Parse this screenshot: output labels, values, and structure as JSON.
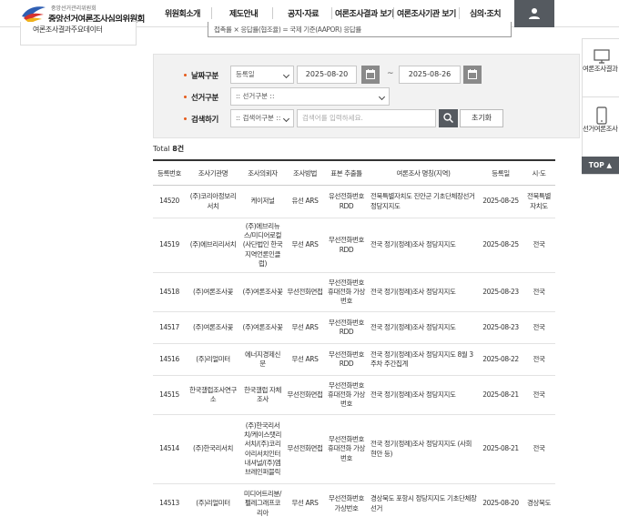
{
  "header": {
    "logo_small": "중앙선거관리위원회",
    "logo_big": "중앙선거여론조사심의위원회",
    "nav": [
      "위원회소개",
      "제도안내",
      "공지·자료",
      "여론조사결과 보기",
      "여론조사기관 보기",
      "심의·조치"
    ]
  },
  "sidebar": {
    "item": "여론조사결과주요데이터"
  },
  "info_strip": {
    "text": "접촉률 × 응답률(협조율) = 국제 기준(AAPOR) 응답률"
  },
  "search": {
    "date_label": "날짜구분",
    "date_type": "등록일",
    "date_from": "2025-08-20",
    "date_to": "2025-08-26",
    "tilde": "~",
    "election_label": "선거구분",
    "election_value": ":: 선거구분 ::",
    "keyword_label": "검색하기",
    "keyword_type": ":: 검색어구분 ::",
    "keyword_placeholder": "검색어를 입력하세요.",
    "reset": "초기화"
  },
  "total": {
    "label": "Total",
    "count": "8건"
  },
  "table": {
    "headers": [
      "등록번호",
      "조사기관명",
      "조사의뢰자",
      "조사방법",
      "표본 추출틀",
      "여론조사 명칭(지역)",
      "등록일",
      "시·도"
    ],
    "rows": [
      {
        "no": "14520",
        "agency": "(주)코리아정보리서치",
        "client": "케이저널",
        "method": "유선 ARS",
        "frame": "유선전화번호 RDD",
        "title": "전북특별자치도 진안군 기초단체장선거 정당지지도",
        "date": "2025-08-25",
        "region": "전북특별자치도"
      },
      {
        "no": "14519",
        "agency": "(주)에브리리서치",
        "client": "(주)에브리뉴스/미디어로컬(사단법인 한국지역언론인클럽)",
        "method": "무선 ARS",
        "frame": "무선전화번호 RDD",
        "title": "전국 정기(정례)조사 정당지지도",
        "date": "2025-08-25",
        "region": "전국"
      },
      {
        "no": "14518",
        "agency": "(주)여론조사꽃",
        "client": "(주)여론조사꽃",
        "method": "무선전화면접",
        "frame": "무선전화번호 휴대전화 가상번호",
        "title": "전국 정기(정례)조사 정당지지도",
        "date": "2025-08-23",
        "region": "전국"
      },
      {
        "no": "14517",
        "agency": "(주)여론조사꽃",
        "client": "(주)여론조사꽃",
        "method": "무선 ARS",
        "frame": "무선전화번호 RDD",
        "title": "전국 정기(정례)조사 정당지지도",
        "date": "2025-08-23",
        "region": "전국"
      },
      {
        "no": "14516",
        "agency": "(주)리얼미터",
        "client": "에너지경제신문",
        "method": "무선 ARS",
        "frame": "무선전화번호 RDD",
        "title": "전국 정기(정례)조사 정당지지도 8월 3주차 주간집계",
        "date": "2025-08-22",
        "region": "전국"
      },
      {
        "no": "14515",
        "agency": "한국갤럽조사연구소",
        "client": "한국갤럽 자체조사",
        "method": "무선전화면접",
        "frame": "무선전화번호 휴대전화 가상번호",
        "title": "전국 정기(정례)조사 정당지지도",
        "date": "2025-08-21",
        "region": "전국"
      },
      {
        "no": "14514",
        "agency": "(주)한국리서치",
        "client": "(주)한국리서치/케이스탯리서치/(주)코리아리서치인터내셔널/(주)엠브레인퍼블릭",
        "method": "무선전화면접",
        "frame": "무선전화번호 휴대전화 가상번호",
        "title": "전국 정기(정례)조사 정당지지도 (사회 현안 등)",
        "date": "2025-08-21",
        "region": "전국"
      },
      {
        "no": "14513",
        "agency": "(주)리얼미터",
        "client": "미디어트리뷴/펠레그래프코리아",
        "method": "무선 ARS",
        "frame": "무선전화번호 가상번호",
        "title": "경상북도 포항시 정당지지도 기초단체장선거",
        "date": "2025-08-20",
        "region": "경상북도"
      }
    ]
  },
  "right_float": {
    "pc_label": "여론조사결과 보기",
    "mobile_label": "선거여론조사 기관보기",
    "top": "TOP"
  }
}
